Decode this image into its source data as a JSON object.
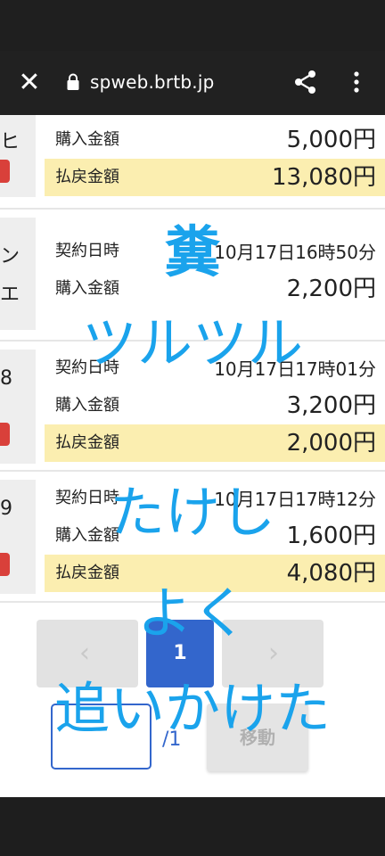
{
  "browser": {
    "url": "spweb.brtb.jp",
    "close_icon": "close-icon",
    "lock_icon": "lock-icon",
    "share_icon": "share-icon",
    "more_icon": "more-vert-icon"
  },
  "cards": [
    {
      "thumb_text": "ヒ",
      "rows": [
        {
          "label": "購入金額",
          "value": "5,000円"
        },
        {
          "label": "払戻金額",
          "value": "13,080円"
        }
      ]
    },
    {
      "thumb_text": "ン",
      "thumb_text2": "エ",
      "rows": [
        {
          "label": "契約日時",
          "value": "10月17日16時50分"
        },
        {
          "label": "購入金額",
          "value": "2,200円"
        }
      ]
    },
    {
      "thumb_text": "8",
      "rows": [
        {
          "label": "契約日時",
          "value": "10月17日17時01分"
        },
        {
          "label": "購入金額",
          "value": "3,200円"
        },
        {
          "label": "払戻金額",
          "value": "2,000円"
        }
      ]
    },
    {
      "thumb_text": "9",
      "rows": [
        {
          "label": "契約日時",
          "value": "10月17日17時12分"
        },
        {
          "label": "購入金額",
          "value": "1,600円"
        },
        {
          "label": "払戻金額",
          "value": "4,080円"
        }
      ]
    }
  ],
  "pagination": {
    "prev": "‹",
    "current": "1",
    "next": "›",
    "total": "/1",
    "input_value": "",
    "move_label": "移動"
  },
  "overlay_text": {
    "line1": "糞",
    "line2": "ツルツル",
    "line3": "たけし",
    "line4": "よく",
    "line5": "追いかけた"
  },
  "colors": {
    "highlight": "#fbeeb0",
    "accent": "#3366cc",
    "overlay": "#1aa3ec",
    "badge_red": "#d9403a"
  }
}
